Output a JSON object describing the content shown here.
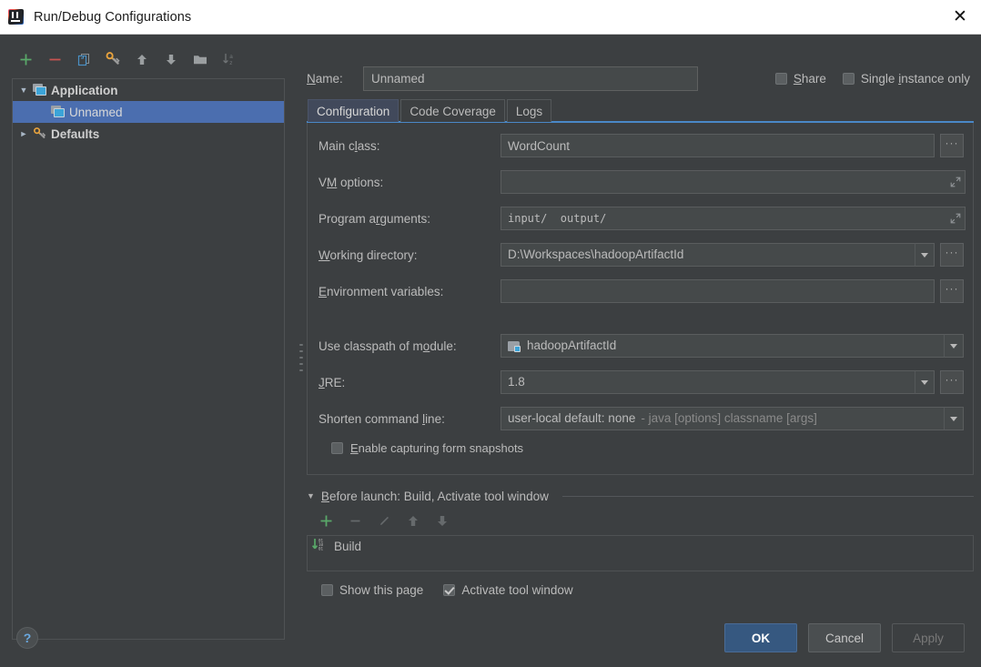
{
  "window": {
    "title": "Run/Debug Configurations",
    "app_icon": "intellij-idea-logo",
    "close_label": "✕"
  },
  "left_panel": {
    "toolbar": [
      {
        "name": "add",
        "icon": "plus-icon",
        "label": "+"
      },
      {
        "name": "remove",
        "icon": "minus-icon",
        "label": "−"
      },
      {
        "name": "copy",
        "icon": "copy-icon",
        "label": ""
      },
      {
        "name": "edit-defaults",
        "icon": "wrench-key-icon",
        "label": ""
      },
      {
        "name": "move-up",
        "icon": "arrow-up-icon",
        "label": ""
      },
      {
        "name": "move-down",
        "icon": "arrow-down-icon",
        "label": ""
      },
      {
        "name": "new-folder",
        "icon": "folder-icon",
        "label": ""
      },
      {
        "name": "sort-alphabetically",
        "icon": "sort-az-icon",
        "label": ""
      }
    ],
    "tree": [
      {
        "label": "Application",
        "icon": "application-icon",
        "twisty": "▼",
        "type": "group",
        "selected": false,
        "indent": 0
      },
      {
        "label": "Unnamed",
        "icon": "application-icon",
        "twisty": "",
        "type": "item",
        "selected": true,
        "indent": 1
      },
      {
        "label": "Defaults",
        "icon": "wrench-key-icon",
        "twisty": "►",
        "type": "group",
        "selected": false,
        "indent": 0
      }
    ]
  },
  "right_panel": {
    "name_label_prefix": "N",
    "name_label_rest": "ame:",
    "name_value": "Unnamed",
    "share": {
      "prefix": "",
      "mnemonic": "S",
      "rest": "hare"
    },
    "single_instance": {
      "prefix": "Single ",
      "mnemonic": "i",
      "rest": "nstance only"
    },
    "tabs": [
      {
        "label": "Configuration",
        "active": true
      },
      {
        "label": "Code Coverage",
        "active": false
      },
      {
        "label": "Logs",
        "active": false
      }
    ],
    "fields": {
      "main_class": {
        "label_pre": "Main c",
        "label_mn": "l",
        "label_post": "ass:",
        "value": "WordCount",
        "browse": "···"
      },
      "vm_options": {
        "label_pre": "V",
        "label_mn": "M",
        "label_post": " options:",
        "value": "",
        "expand_icon": "expand-diagonal-icon"
      },
      "program_arguments": {
        "label_pre": "Program a",
        "label_mn": "r",
        "label_post": "guments:",
        "value": "input/  output/",
        "expand_icon": "expand-diagonal-icon"
      },
      "working_directory": {
        "label_pre": "",
        "label_mn": "W",
        "label_post": "orking directory:",
        "value": "D:\\Workspaces\\hadoopArtifactId",
        "browse": "···"
      },
      "environment_variables": {
        "label_pre": "",
        "label_mn": "E",
        "label_post": "nvironment variables:",
        "value": "",
        "browse": "···"
      },
      "use_classpath_of_module": {
        "label_pre": "Use classpath of m",
        "label_mn": "o",
        "label_post": "dule:",
        "value": "hadoopArtifactId",
        "icon": "module-icon"
      },
      "jre": {
        "label_pre": "",
        "label_mn": "J",
        "label_post": "RE:",
        "value": "1.8",
        "browse": "···"
      },
      "shorten_command_line": {
        "label_pre": "Shorten command ",
        "label_mn": "l",
        "label_post": "ine:",
        "value_main": "user-local default: none",
        "value_dim": "- java [options] classname [args]"
      },
      "enable_snapshots": {
        "label_pre": "",
        "label_mn": "E",
        "label_post": "nable capturing form snapshots",
        "checked": false
      }
    },
    "before_launch": {
      "twisty": "▼",
      "header_mn": "B",
      "header_rest": "efore launch: Build, Activate tool window",
      "toolbar": [
        {
          "name": "add-task",
          "icon": "plus-icon",
          "enabled": true
        },
        {
          "name": "remove-task",
          "icon": "minus-icon",
          "enabled": false
        },
        {
          "name": "edit-task",
          "icon": "pencil-icon",
          "enabled": false
        },
        {
          "name": "move-task-up",
          "icon": "arrow-up-icon",
          "enabled": false
        },
        {
          "name": "move-task-down",
          "icon": "arrow-down-icon",
          "enabled": false
        }
      ],
      "items": [
        {
          "label": "Build",
          "icon": "build-icon"
        }
      ],
      "show_this_page": {
        "label": "Show this page",
        "checked": false
      },
      "activate_tool_window": {
        "label": "Activate tool window",
        "checked": true
      }
    }
  },
  "footer": {
    "help": "?",
    "ok": "OK",
    "cancel": "Cancel",
    "apply": "Apply"
  },
  "colors": {
    "window_bg": "#3c3f41",
    "field_bg": "#45494a",
    "selection_blue": "#4b6eaf",
    "primary_button": "#365880",
    "tab_active": "#41495b",
    "tab_underline": "#4a88c7",
    "accent_green": "#59a869",
    "accent_red": "#c75450"
  }
}
